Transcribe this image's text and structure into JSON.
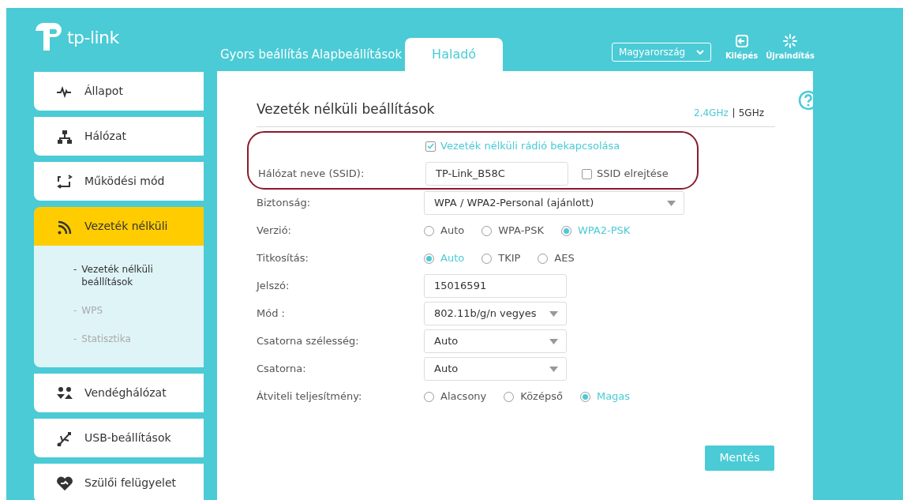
{
  "header": {
    "logo_text": "tp-link",
    "nav": [
      {
        "label": "Gyors beállítás",
        "selected": false
      },
      {
        "label": "Alapbeállítások",
        "selected": false
      },
      {
        "label": "Haladó",
        "selected": true
      }
    ],
    "region_select": {
      "value": "Magyarország"
    },
    "actions": [
      {
        "kind": "logout",
        "label": "Kilépés"
      },
      {
        "kind": "reboot",
        "label": "Újraindítás"
      }
    ]
  },
  "sidebar": {
    "items": [
      {
        "kind": "status",
        "label": "Állapot",
        "selected": false
      },
      {
        "kind": "network",
        "label": "Hálózat",
        "selected": false
      },
      {
        "kind": "mode",
        "label": "Működési mód",
        "selected": false
      },
      {
        "kind": "wireless",
        "label": "Vezeték nélküli",
        "selected": true,
        "children": [
          {
            "marker": "-",
            "label": "Vezeték nélküli beállítások",
            "selected": true
          },
          {
            "marker": "-",
            "label": "WPS",
            "selected": false
          },
          {
            "marker": "-",
            "label": "Statisztika",
            "selected": false
          }
        ]
      },
      {
        "kind": "guest",
        "label": "Vendéghálózat",
        "selected": false
      },
      {
        "kind": "usb",
        "label": "USB-beállítások",
        "selected": false
      },
      {
        "kind": "parental",
        "label": "Szülői felügyelet",
        "selected": false
      }
    ]
  },
  "main": {
    "title": "Vezeték nélküli beállítások",
    "bands": [
      {
        "label": "2,4GHz",
        "selected": true
      },
      {
        "label": "5GHz",
        "selected": false
      }
    ],
    "rows": [
      {
        "kind": "checkbox",
        "label": "Vezeték nélküli rádió bekapcsolása",
        "checked": true,
        "highlighted": true
      },
      {
        "kind": "text",
        "label": "Hálózat neve (SSID):",
        "value": "TP-Link_B58C",
        "option": {
          "label": "SSID elrejtése",
          "checked": false
        },
        "highlighted": true
      },
      {
        "kind": "select",
        "label": "Biztonság:",
        "value": "WPA / WPA2-Personal (ajánlott)",
        "wide": true,
        "highlighted": false
      },
      {
        "kind": "radio",
        "label": "Verzió:",
        "options": [
          {
            "label": "Auto",
            "selected": false
          },
          {
            "label": "WPA-PSK",
            "selected": false
          },
          {
            "label": "WPA2-PSK",
            "selected": true
          }
        ],
        "highlighted": false
      },
      {
        "kind": "radio",
        "label": "Titkosítás:",
        "options": [
          {
            "label": "Auto",
            "selected": true
          },
          {
            "label": "TKIP",
            "selected": false
          },
          {
            "label": "AES",
            "selected": false
          }
        ],
        "highlighted": false
      },
      {
        "kind": "text",
        "label": "Jelszó:",
        "value": "15016591",
        "highlighted": false
      },
      {
        "kind": "select",
        "label": "Mód :",
        "value": "802.11b/g/n vegyes",
        "wide": false,
        "highlighted": false
      },
      {
        "kind": "select",
        "label": "Csatorna szélesség:",
        "value": "Auto",
        "wide": false,
        "highlighted": false
      },
      {
        "kind": "select",
        "label": "Csatorna:",
        "value": "Auto",
        "wide": false,
        "highlighted": false
      },
      {
        "kind": "radio",
        "label": "Átviteli teljesítmény:",
        "options": [
          {
            "label": "Alacsony",
            "selected": false
          },
          {
            "label": "Középső",
            "selected": false
          },
          {
            "label": "Magas",
            "selected": true
          }
        ],
        "highlighted": false
      }
    ],
    "save_button": "Mentés"
  }
}
